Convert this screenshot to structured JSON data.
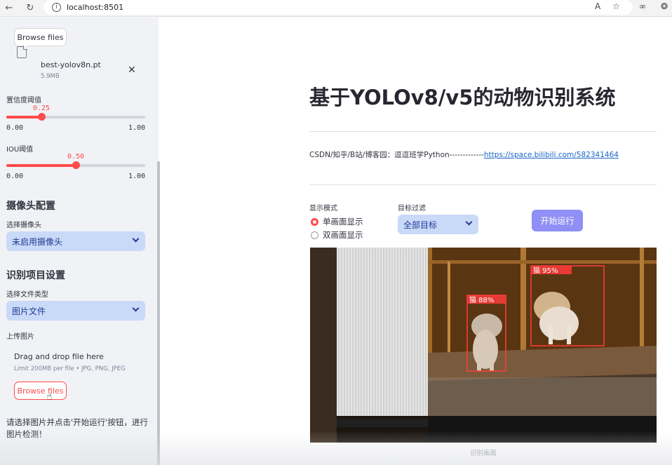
{
  "browser": {
    "url": "localhost:8501"
  },
  "sidebar": {
    "model_upload": {
      "browse_label": "Browse files",
      "file_name": "best-yolov8n.pt",
      "file_size": "5.9MB"
    },
    "confidence": {
      "label": "置信度阈值",
      "value": "0.25",
      "min": "0.00",
      "max": "1.00",
      "fraction": 0.25
    },
    "iou": {
      "label": "IOU阈值",
      "value": "0.50",
      "min": "0.00",
      "max": "1.00",
      "fraction": 0.5
    },
    "camera_section": {
      "title": "摄像头配置",
      "select_label": "选择摄像头",
      "select_value": "未启用摄像头"
    },
    "detection_section": {
      "title": "识别项目设置",
      "file_type_label": "选择文件类型",
      "file_type_value": "图片文件",
      "upload_label": "上传图片",
      "dropzone_title": "Drag and drop file here",
      "dropzone_limit": "Limit 200MB per file • JPG, PNG, JPEG",
      "browse_label": "Browse files"
    },
    "info_message": "请选择图片并点击'开始运行'按钮，进行图片检测！"
  },
  "main": {
    "title": "基于YOLOv8/v5的动物识别系统",
    "credit_text": "CSDN/知乎/B站/博客园：逗逗班学Python-------------",
    "credit_link": "https://space.bilibili.com/582341464",
    "display_mode": {
      "label": "显示模式",
      "options": [
        "单画面显示",
        "双画面显示"
      ],
      "selected": 0
    },
    "target_filter": {
      "label": "目标过滤",
      "value": "全部目标"
    },
    "run_button": "开始运行",
    "detections": [
      {
        "label": "猫 88%"
      },
      {
        "label": "猫 95%"
      }
    ],
    "image_caption": "识别画面"
  },
  "colors": {
    "accent": "#ff4b4b",
    "select_bg": "#c9d9f8",
    "run_button": "#8f8ff5",
    "sidebar_bg": "#f0f2f6"
  }
}
